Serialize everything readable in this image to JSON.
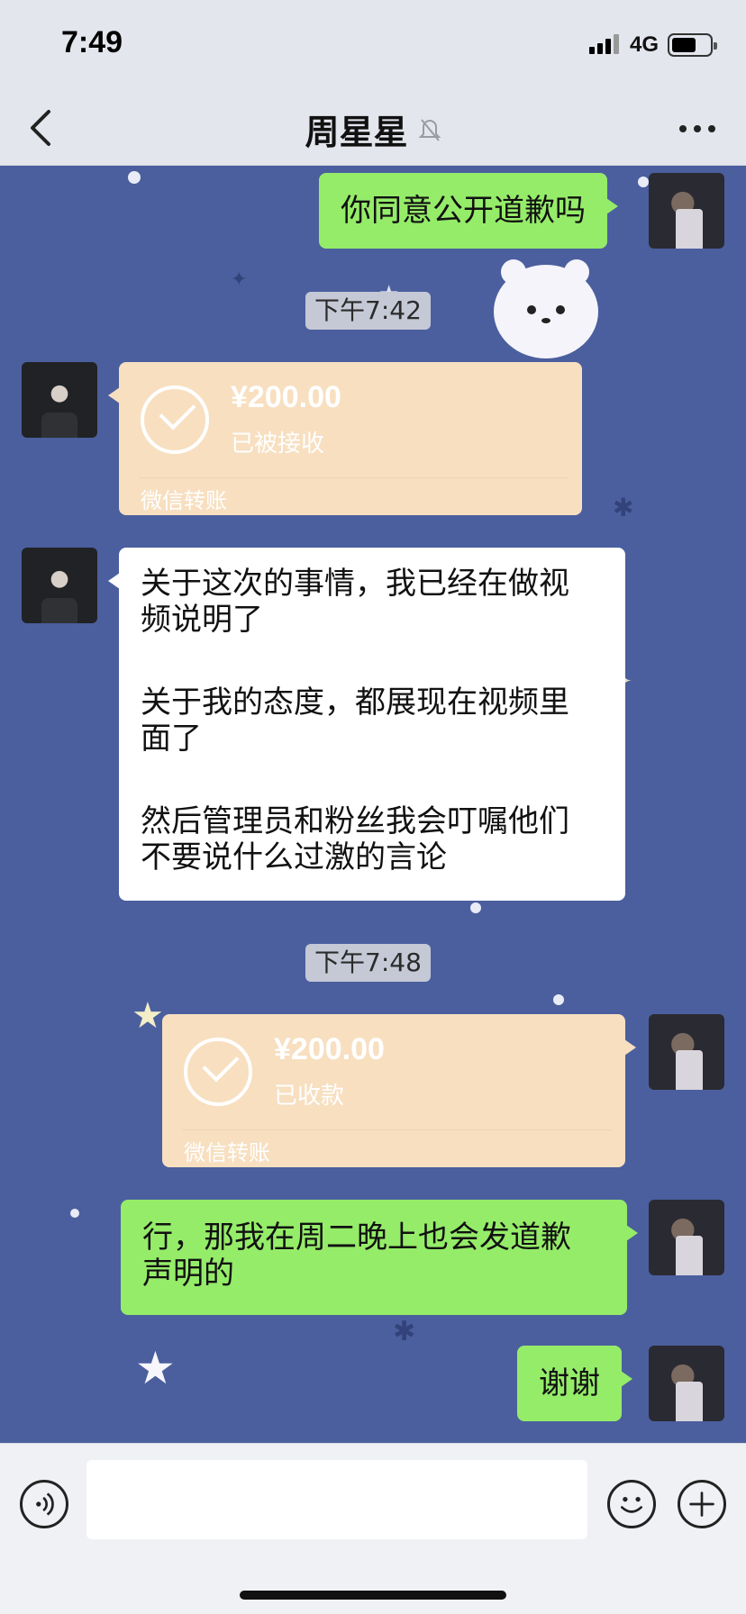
{
  "status_bar": {
    "time": "7:49",
    "network": "4G"
  },
  "header": {
    "title": "周星星",
    "back_icon": "chevron-left-icon",
    "mute_icon": "bell-slash-icon",
    "more_icon": "ellipsis-icon"
  },
  "messages": [
    {
      "type": "text",
      "sender": "me",
      "lines": [
        "你同意公开道歉吗"
      ]
    },
    {
      "type": "timestamp",
      "text": "下午7:42"
    },
    {
      "type": "transfer",
      "sender": "other",
      "amount": "¥200.00",
      "status": "已被接收",
      "label": "微信转账"
    },
    {
      "type": "text",
      "sender": "other",
      "lines": [
        "关于这次的事情，我已经在做视",
        "频说明了",
        "关于我的态度，都展现在视频里",
        "面了",
        "然后管理员和粉丝我会叮嘱他们",
        "不要说什么过激的言论"
      ]
    },
    {
      "type": "timestamp",
      "text": "下午7:48"
    },
    {
      "type": "transfer",
      "sender": "me",
      "amount": "¥200.00",
      "status": "已收款",
      "label": "微信转账"
    },
    {
      "type": "text",
      "sender": "me",
      "lines": [
        "行，那我在周二晚上也会发道歉",
        "声明的"
      ]
    },
    {
      "type": "text",
      "sender": "me",
      "lines": [
        "谢谢"
      ]
    }
  ],
  "input_bar": {
    "voice_icon": "voice-icon",
    "emoji_icon": "emoji-icon",
    "plus_icon": "plus-icon",
    "input_value": ""
  },
  "colors": {
    "chat_background": "#4b5f9e",
    "sent_bubble": "#95ec69",
    "received_bubble": "#ffffff",
    "transfer_card": "#f7dfc0"
  }
}
